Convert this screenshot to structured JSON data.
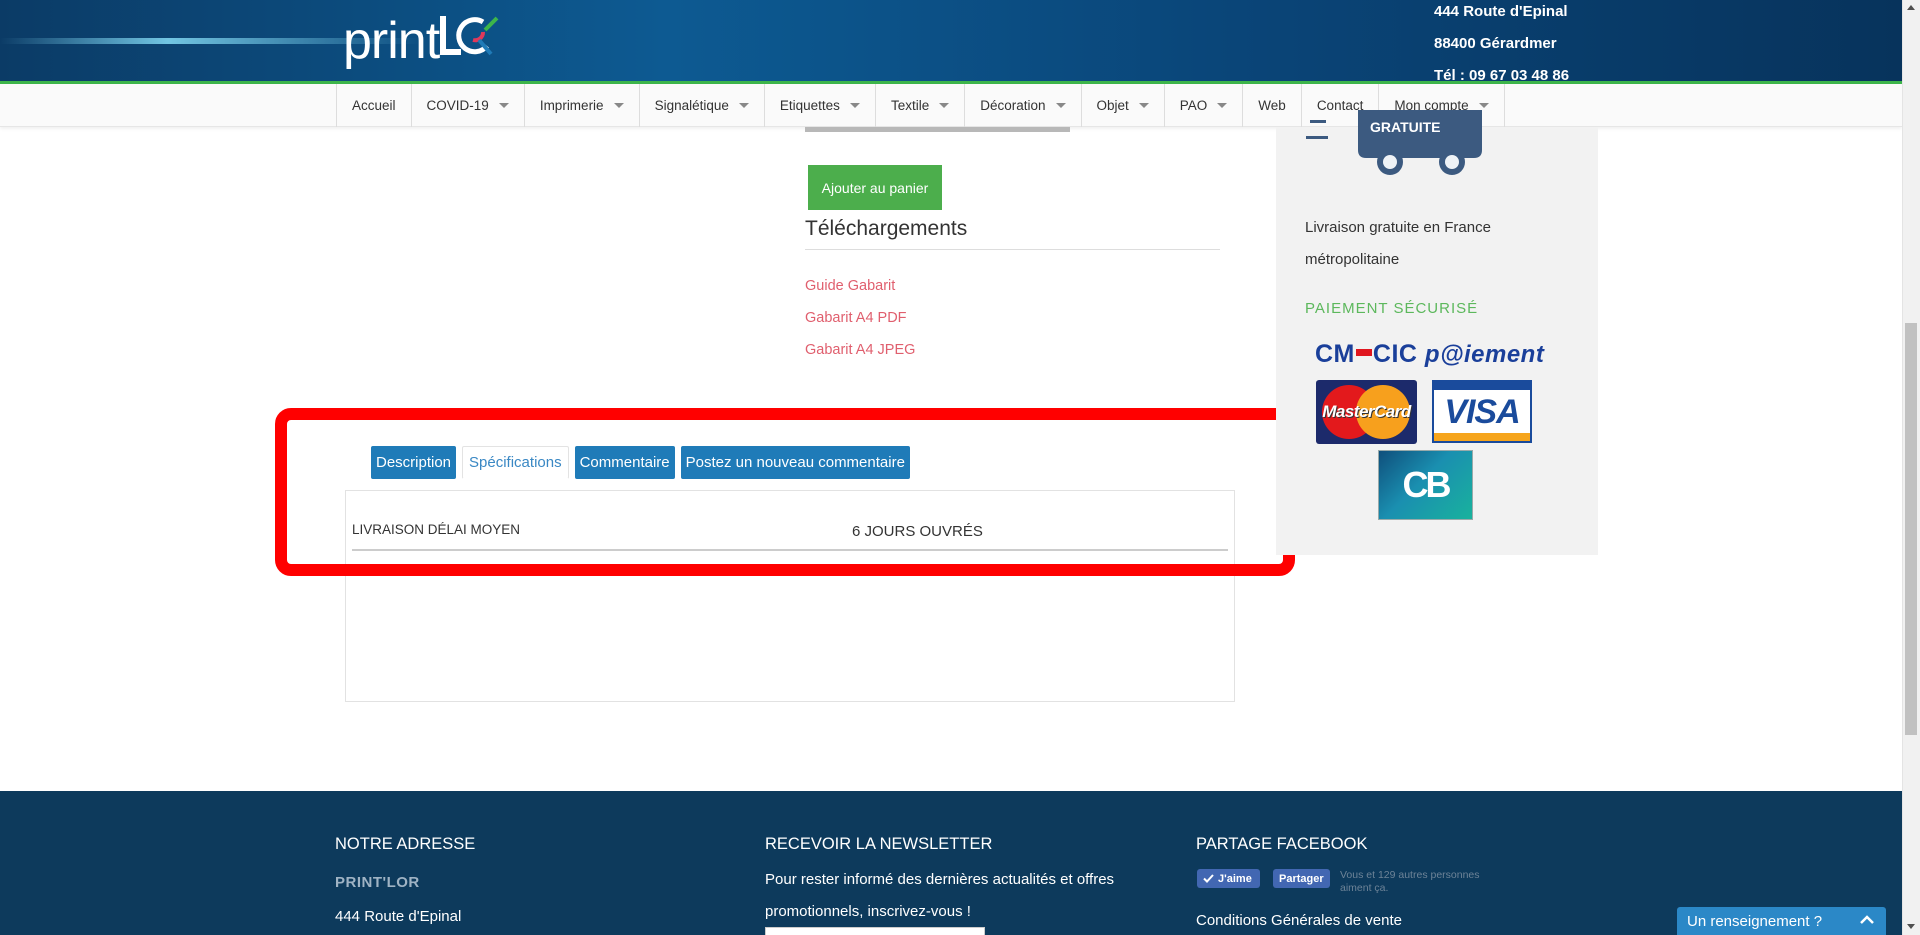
{
  "header": {
    "logo_text": "print",
    "logo_mark": "LOR",
    "address_line1": "444 Route d'Epinal",
    "address_line2": "88400 Gérardmer",
    "phone": "Tél : 09 67 03 48 86",
    "gradient_color": "#0d5a92",
    "accent_green": "#3db54a"
  },
  "nav": {
    "items": [
      {
        "label": "Accueil",
        "dropdown": false
      },
      {
        "label": "COVID-19",
        "dropdown": true
      },
      {
        "label": "Imprimerie",
        "dropdown": true
      },
      {
        "label": "Signalétique",
        "dropdown": true
      },
      {
        "label": "Etiquettes",
        "dropdown": true
      },
      {
        "label": "Textile",
        "dropdown": true
      },
      {
        "label": "Décoration",
        "dropdown": true
      },
      {
        "label": "Objet",
        "dropdown": true
      },
      {
        "label": "PAO",
        "dropdown": true
      },
      {
        "label": "Web",
        "dropdown": false
      },
      {
        "label": "Contact",
        "dropdown": false
      },
      {
        "label": "Mon compte",
        "dropdown": true
      }
    ]
  },
  "product": {
    "add_to_cart": "Ajouter au panier",
    "downloads_title": "Téléchargements",
    "downloads": [
      "Guide Gabarit",
      "Gabarit A4 PDF",
      "Gabarit A4 JPEG"
    ]
  },
  "tabs": {
    "items": [
      "Description",
      "Spécifications",
      "Commentaire",
      "Postez un nouveau commentaire"
    ],
    "active": "Spécifications"
  },
  "specifications": {
    "rows": [
      {
        "label": "LIVRAISON DÉLAI MOYEN",
        "value": "6 JOURS OUVRÉS"
      }
    ]
  },
  "sidebar": {
    "truck_badge": "GRATUITE",
    "delivery_text": "Livraison gratuite en France métropolitaine",
    "payment_heading": "PAIEMENT SÉCURISÉ",
    "cmcic": {
      "cm": "CM",
      "cic": "CIC",
      "paiement": "p@iement"
    },
    "cards": {
      "mastercard": "MasterCard",
      "visa": "VISA",
      "cb": "CB"
    }
  },
  "footer": {
    "address_heading": "NOTRE ADRESSE",
    "company": "PRINT'LOR",
    "street": "444 Route d'Epinal",
    "newsletter_heading": "RECEVOIR LA NEWSLETTER",
    "newsletter_text": "Pour rester informé des dernières actualités et offres promotionnels, inscrivez-vous !",
    "facebook_heading": "PARTAGE FACEBOOK",
    "fb_like": "J'aime",
    "fb_share": "Partager",
    "fb_count": "Vous et 129 autres personnes aiment ça.",
    "cgv_link": "Conditions Générales de vente"
  },
  "chat": {
    "label": "Un renseignement ?",
    "icon": "chevron-up-icon"
  },
  "colors": {
    "tab_blue": "#1f7bb8",
    "link_red": "#e05f6e",
    "cart_green": "#4cae4c",
    "footer_bg": "#0d3a5c",
    "annotation_red": "#ff0000"
  }
}
